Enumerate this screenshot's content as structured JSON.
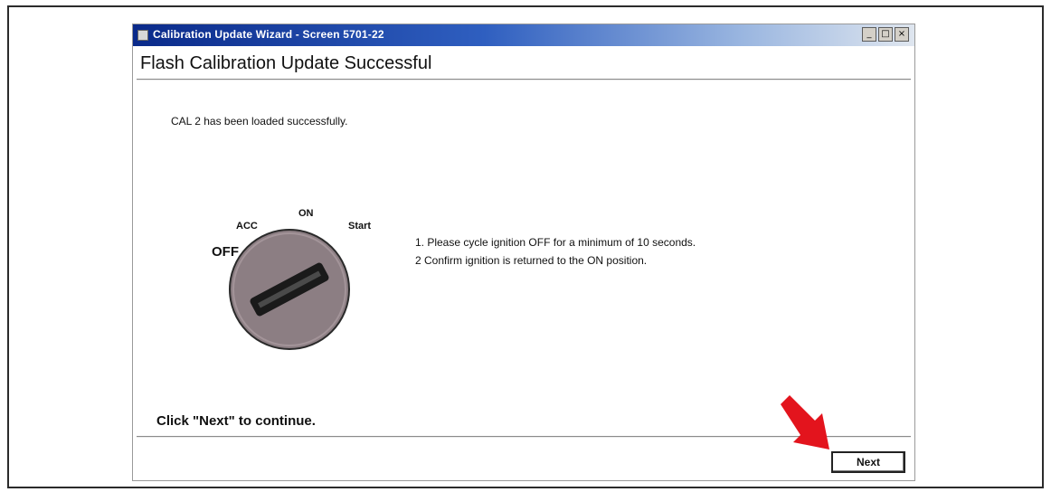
{
  "window": {
    "title": "Calibration Update Wizard - Screen 5701-22",
    "minimize_glyph": "_",
    "maximize_glyph": "□",
    "close_glyph": "×"
  },
  "header": {
    "title": "Flash Calibration Update Successful"
  },
  "status": {
    "message": "CAL 2 has been loaded successfully."
  },
  "ignition_dial": {
    "labels": {
      "off": "OFF",
      "acc": "ACC",
      "on": "ON",
      "start": "Start"
    },
    "dial_color": "#8c7e83"
  },
  "instructions": [
    "1. Please cycle ignition OFF for a minimum of 10 seconds.",
    "2  Confirm ignition is returned to the ON position."
  ],
  "footer": {
    "continue_text": "Click \"Next\" to continue.",
    "next_label": "Next"
  },
  "colors": {
    "arrow": "#e3141d",
    "titlebar_start": "#0a2a8a"
  }
}
